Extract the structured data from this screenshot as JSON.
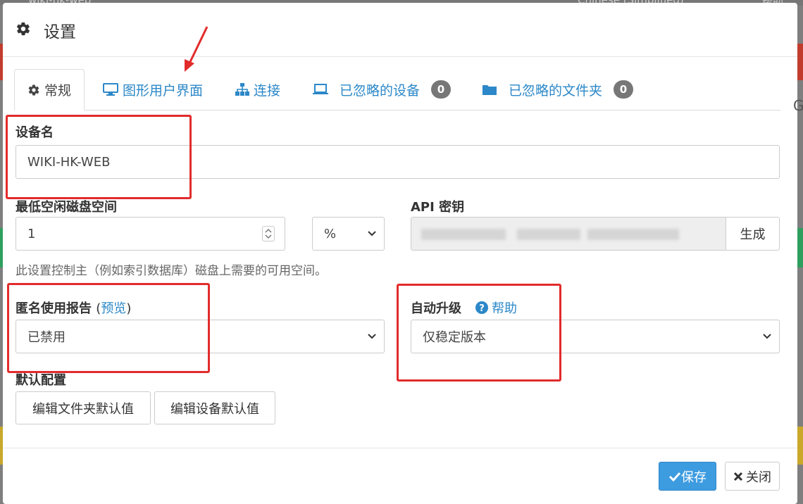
{
  "modal": {
    "title": "设置",
    "icon": "gear-icon"
  },
  "tabs": [
    {
      "label": "常规",
      "icon": "gear-icon"
    },
    {
      "label": "图形用户界面",
      "icon": "monitor-icon"
    },
    {
      "label": "连接",
      "icon": "sitemap-icon"
    },
    {
      "label": "已忽略的设备",
      "icon": "laptop-icon",
      "badge": "0"
    },
    {
      "label": "已忽略的文件夹",
      "icon": "folder-icon",
      "badge": "0"
    }
  ],
  "device_name": {
    "label": "设备名",
    "value": "WIKI-HK-WEB"
  },
  "min_disk": {
    "label": "最低空闲磁盘空间",
    "value": "1",
    "unit": "%",
    "hint": "此设置控制主（例如索引数据库）磁盘上需要的可用空间。"
  },
  "api_key": {
    "label": "API 密钥",
    "generate_label": "生成"
  },
  "usage_report": {
    "label": "匿名使用报告",
    "preview_open": "(",
    "preview_link": "预览",
    "preview_close": ")",
    "value": "已禁用"
  },
  "auto_upgrade": {
    "label": "自动升级",
    "help_label": "帮助",
    "value": "仅稳定版本"
  },
  "defaults": {
    "label": "默认配置",
    "folder_button": "编辑文件夹默认值",
    "device_button": "编辑设备默认值"
  },
  "footer": {
    "save_label": "保存",
    "close_label": "关闭"
  },
  "background": {
    "left_text": "wiki-hk-web",
    "right_text": "Chinese (Simplified)",
    "right_help": "帮助",
    "edge_letter": "G"
  },
  "colors": {
    "accent": "#2c88c8",
    "primary_button": "#3d9be0",
    "annotation_red": "#e22b2b",
    "badge": "#777777"
  }
}
